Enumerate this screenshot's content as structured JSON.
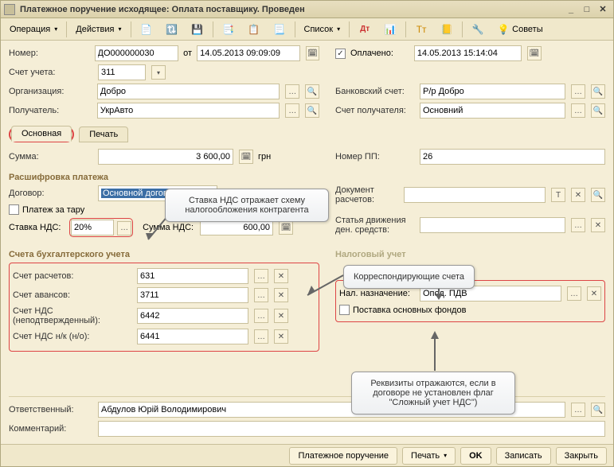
{
  "window": {
    "title": "Платежное поручение исходящее: Оплата поставщику. Проведен"
  },
  "toolbar": {
    "operation": "Операция",
    "actions": "Действия",
    "list": "Список",
    "advice": "Советы"
  },
  "header": {
    "number_lbl": "Номер:",
    "number": "ДО000000030",
    "from_lbl": "от",
    "date": "14.05.2013 09:09:09",
    "paid_lbl": "Оплачено:",
    "paid_date": "14.05.2013 15:14:04",
    "account_lbl": "Счет учета:",
    "account": "311",
    "org_lbl": "Организация:",
    "org": "Добро",
    "bank_lbl": "Банковский счет:",
    "bank": "Р/р Добро",
    "recipient_lbl": "Получатель:",
    "recipient": "УкрАвто",
    "recipient_acc_lbl": "Счет получателя:",
    "recipient_acc": "Основний"
  },
  "tabs": {
    "main": "Основная",
    "print": "Печать"
  },
  "main": {
    "sum_lbl": "Сумма:",
    "sum": "3 600,00",
    "currency": "грн",
    "pp_lbl": "Номер ПП:",
    "pp": "26",
    "decode_title": "Расшифровка платежа",
    "contract_lbl": "Договор:",
    "contract": "Основной договор",
    "doc_calc_lbl": "Документ расчетов:",
    "tare_lbl": "Платеж за тару",
    "move_lbl": "Статья движения ден. средств:",
    "vat_rate_lbl": "Ставка НДС:",
    "vat_rate": "20%",
    "vat_sum_lbl": "Сумма НДС:",
    "vat_sum": "600,00",
    "accounts_title": "Счета бухгалтерского учета",
    "acc_calc_lbl": "Счет расчетов:",
    "acc_calc": "631",
    "acc_adv_lbl": "Счет авансов:",
    "acc_adv": "3711",
    "acc_vat_unc_lbl": "Счет НДС (неподтвержденный):",
    "acc_vat_unc": "6442",
    "acc_vat_nk_lbl": "Счет НДС н/к (н/о):",
    "acc_vat_nk": "6441",
    "tax_title": "Налоговый учет",
    "tax_dest_lbl": "Нал. назначение:",
    "tax_dest": "Опод. ПДВ",
    "supply_fixed_lbl": "Поставка основных фондов",
    "responsible_lbl": "Ответственный:",
    "responsible": "Абдулов Юрій Володимирович",
    "comment_lbl": "Комментарий:"
  },
  "callouts": {
    "vat_scheme": "Ставка НДС отражает схему налогообложения контрагента",
    "corr": "Корреспондирующие счета",
    "req": "Реквизиты отражаются, если в договоре не установлен флаг \"Сложный учет НДС\")"
  },
  "footer": {
    "pp": "Платежное поручение",
    "print": "Печать",
    "ok": "OK",
    "save": "Записать",
    "close": "Закрыть"
  }
}
